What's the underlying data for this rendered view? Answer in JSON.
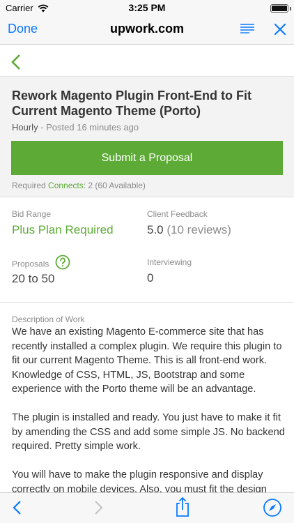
{
  "status_bar": {
    "carrier": "Carrier",
    "time": "3:25 PM",
    "battery_level": 1.0
  },
  "browser": {
    "done_label": "Done",
    "title": "upwork.com",
    "load_progress": 0.4,
    "icons": {
      "reader": "reader-lines-icon",
      "close": "close-x-icon",
      "back": "chevron-left-icon",
      "forward": "chevron-right-icon",
      "share": "share-icon",
      "safari": "compass-icon"
    },
    "accent_color": "#0a7aff"
  },
  "job": {
    "title": "Rework Magento Plugin Front-End to Fit Current Magento Theme (Porto)",
    "type": "Hourly",
    "posted": " - Posted 16 minutes ago",
    "submit_label": "Submit a Proposal",
    "connects_prefix": "Required ",
    "connects_link": "Connects",
    "connects_suffix": ": 2 (60 Available)",
    "brand_color": "#5dab36"
  },
  "stats": {
    "bid_range_label": "Bid Range",
    "bid_range_value": "Plus Plan Required",
    "client_feedback_label": "Client Feedback",
    "client_feedback_score": "5.0",
    "client_feedback_reviews": " (10 reviews)",
    "proposals_label": "Proposals",
    "proposals_value": "20 to 50",
    "interviewing_label": "Interviewing",
    "interviewing_value": "0"
  },
  "description": {
    "label": "Description of Work",
    "paragraphs": [
      "We have an existing Magento E-commerce site that has recently installed a complex plugin. We require this plugin to fit our current Magento Theme. This is all front-end work. Knowledge of CSS, HTML, JS, Bootstrap and some experience with the Porto theme will be an advantage.",
      "The plugin is installed and ready. You just have to make it fit by amending the CSS and add some simple JS. No backend required. Pretty simple work.",
      "You will have to make the plugin responsive and display correctly on mobile devices. Also, you must fit the design"
    ]
  }
}
